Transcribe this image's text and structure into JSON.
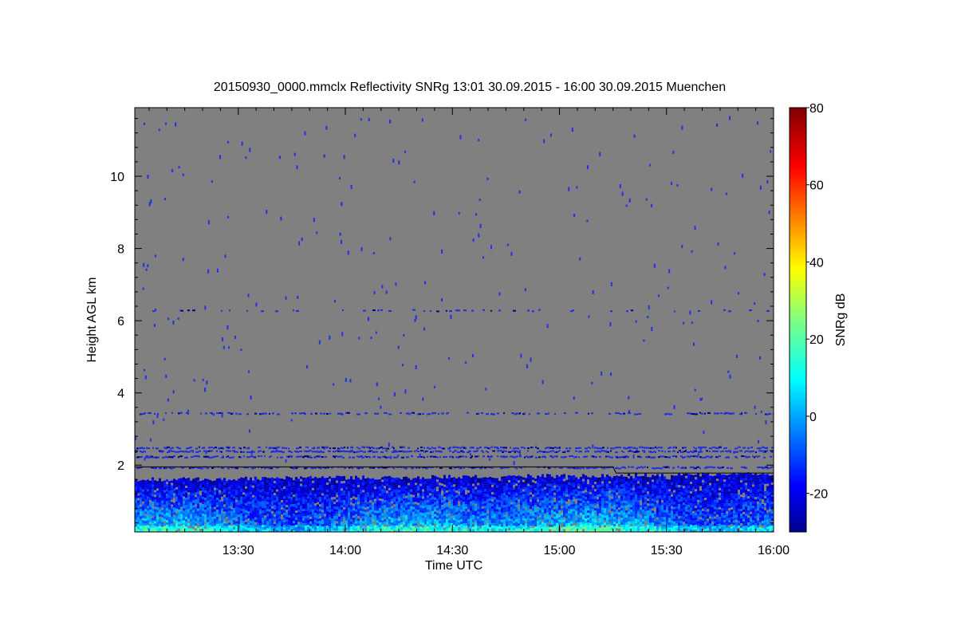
{
  "chart_data": [
    {
      "type": "heatmap",
      "title": "20150930_0000.mmclx Reflectivity SNRg   13:01 30.09.2015 - 16:00 30.09.2015 Muenchen",
      "xlabel": "Time UTC",
      "ylabel": "Height AGL km",
      "x_ticks": [
        "13:30",
        "14:00",
        "14:30",
        "15:00",
        "15:30",
        "16:00"
      ],
      "x_tick_minutes": [
        30,
        60,
        90,
        120,
        150,
        180
      ],
      "x_range_minutes": [
        1,
        180
      ],
      "y_ticks": [
        "2",
        "4",
        "6",
        "8",
        "10"
      ],
      "y_tick_values": [
        2,
        4,
        6,
        8,
        10
      ],
      "ylim": [
        0.15,
        11.9
      ],
      "background_color": "#808080",
      "features": {
        "boundary_layer_top_km": [
          1.6,
          1.75
        ],
        "noise_band_heights_km": [
          1.95,
          2.25,
          2.4,
          2.5,
          3.45,
          6.3
        ],
        "black_line_height_km": [
          1.95,
          1.78
        ]
      },
      "colorbar": {
        "label": "SNRg dB",
        "range": [
          -30,
          80
        ],
        "ticks": [
          "80",
          "60",
          "40",
          "20",
          "0",
          "-20"
        ],
        "tick_values": [
          80,
          60,
          40,
          20,
          0,
          -20
        ],
        "colormap": "jet"
      }
    }
  ]
}
